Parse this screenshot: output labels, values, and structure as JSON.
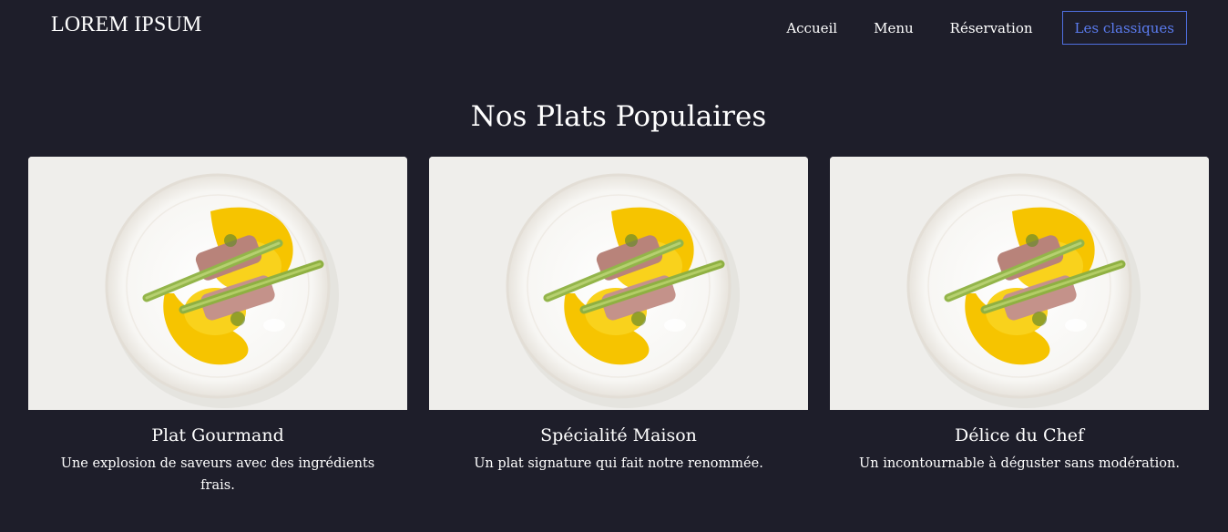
{
  "header": {
    "logo": "LOREM IPSUM",
    "nav": [
      "Accueil",
      "Menu",
      "Réservation"
    ],
    "cta": "Les classiques"
  },
  "section": {
    "title": "Nos Plats Populaires"
  },
  "cards": [
    {
      "title": "Plat Gourmand",
      "description": "Une explosion de saveurs avec des ingrédients frais.",
      "image": "plated-dish-photo"
    },
    {
      "title": "Spécialité Maison",
      "description": "Un plat signature qui fait notre renommée.",
      "image": "plated-dish-photo"
    },
    {
      "title": "Délice du Chef",
      "description": "Un incontournable à déguster sans modération.",
      "image": "plated-dish-photo"
    }
  ],
  "colors": {
    "background": "#1e1e2a",
    "accent": "#5b7cf0",
    "text": "#ffffff"
  }
}
